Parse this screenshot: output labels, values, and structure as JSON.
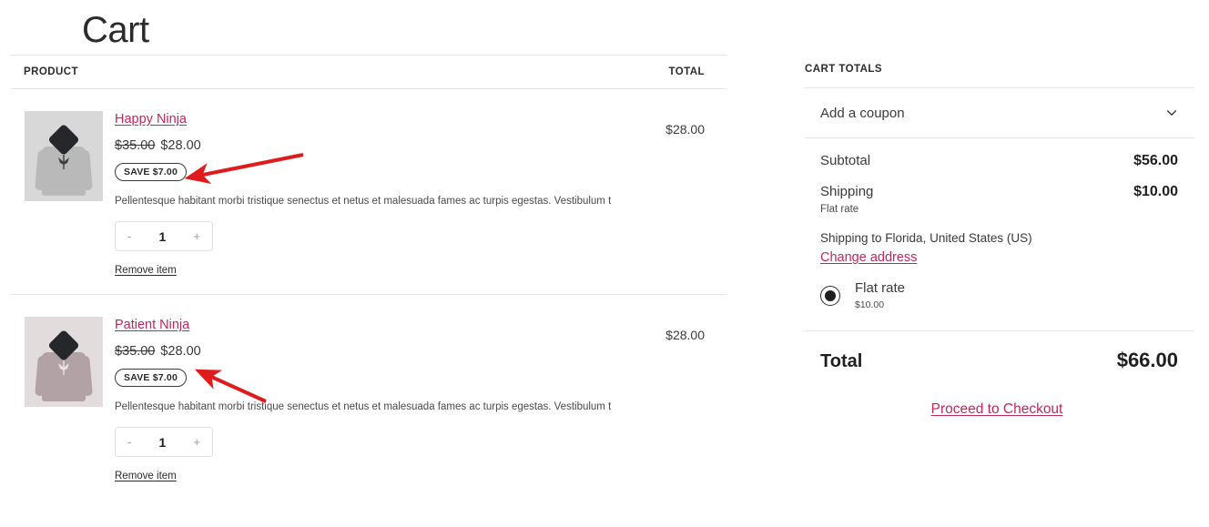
{
  "page": {
    "title": "Cart"
  },
  "table": {
    "columns": {
      "product": "PRODUCT",
      "total": "TOTAL"
    },
    "items": [
      {
        "name": "Happy Ninja",
        "price_old": "$35.00",
        "price_new": "$28.00",
        "save_badge": "SAVE $7.00",
        "description": "Pellentesque habitant morbi tristique senectus et netus et malesuada fames ac turpis egestas. Vestibulum tortor...",
        "qty_minus": "-",
        "qty_value": "1",
        "qty_plus": "+",
        "remove_label": "Remove item",
        "line_total": "$28.00",
        "thumb_style": "gray"
      },
      {
        "name": "Patient Ninja",
        "price_old": "$35.00",
        "price_new": "$28.00",
        "save_badge": "SAVE $7.00",
        "description": "Pellentesque habitant morbi tristique senectus et netus et malesuada fames ac turpis egestas. Vestibulum tortor...",
        "qty_minus": "-",
        "qty_value": "1",
        "qty_plus": "+",
        "remove_label": "Remove item",
        "line_total": "$28.00",
        "thumb_style": "mauve"
      }
    ]
  },
  "totals": {
    "heading": "CART TOTALS",
    "coupon_label": "Add a coupon",
    "subtotal_label": "Subtotal",
    "subtotal_value": "$56.00",
    "shipping_label": "Shipping",
    "shipping_value": "$10.00",
    "shipping_method_note": "Flat rate",
    "shipping_to": "Shipping to Florida, United States (US)",
    "change_address_label": "Change address",
    "shipping_option_name": "Flat rate",
    "shipping_option_price": "$10.00",
    "total_label": "Total",
    "total_value": "$66.00",
    "checkout_label": "Proceed to Checkout"
  },
  "colors": {
    "link": "#c2265b",
    "text": "#2b2b2b",
    "rule": "#e4e4e4",
    "annotation_arrow": "#e01b1b"
  }
}
